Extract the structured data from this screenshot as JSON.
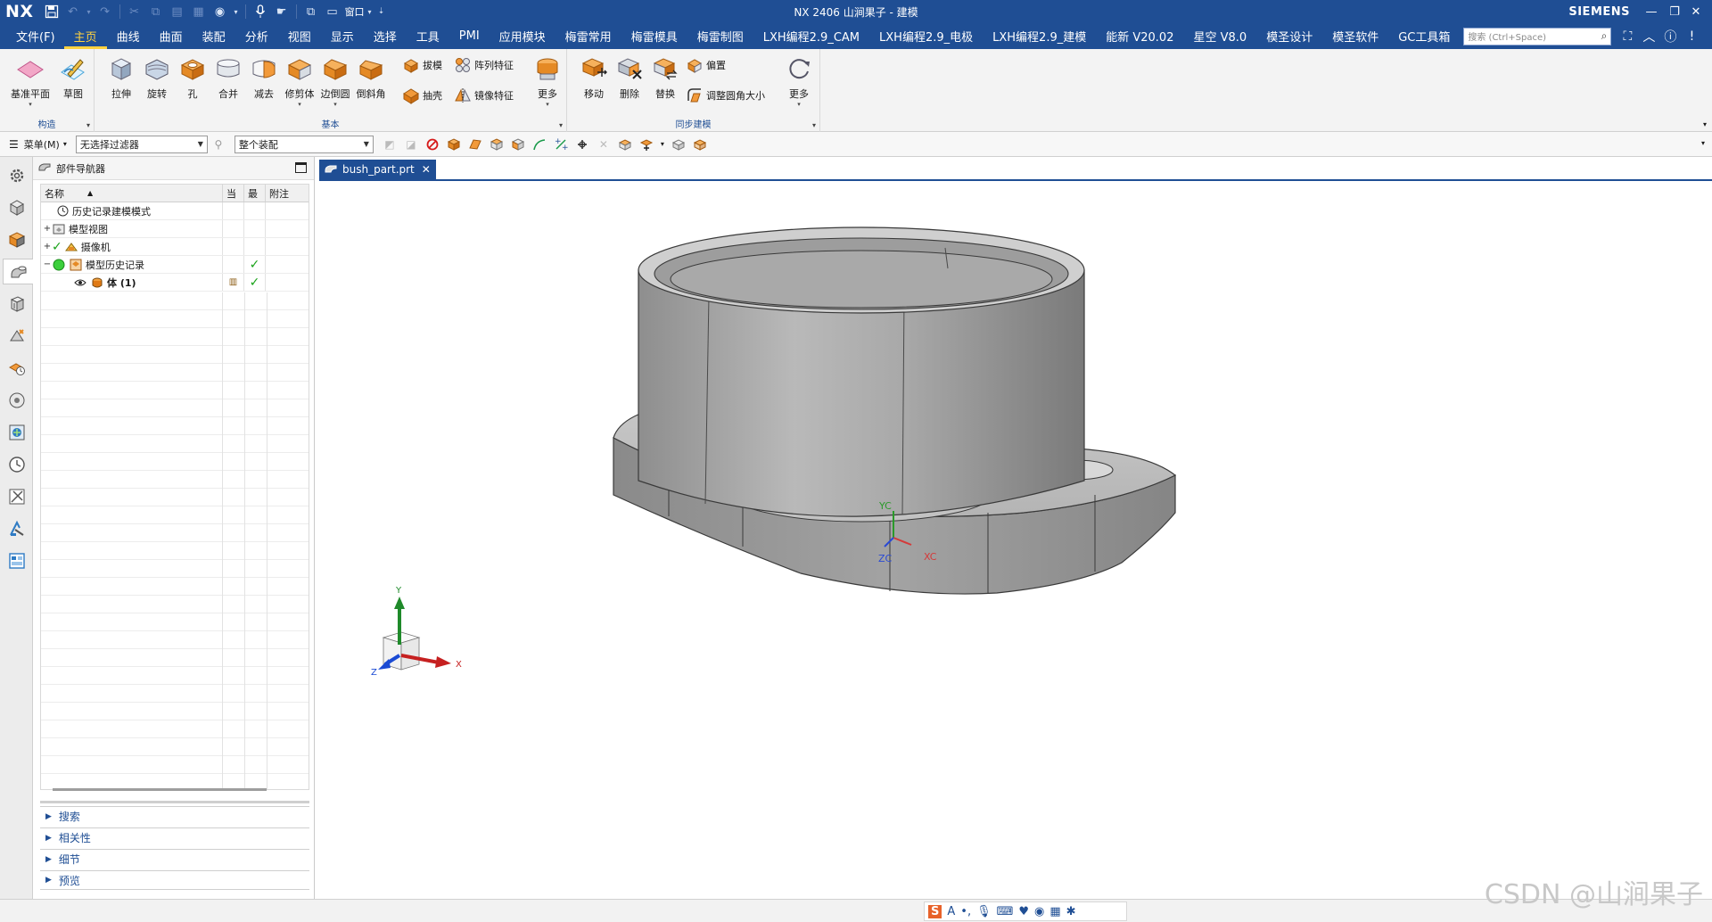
{
  "app": {
    "logo": "NX",
    "title": "NX 2406 山涧果子 - 建模",
    "brand": "SIEMENS",
    "window_menu_label": "窗口"
  },
  "tabs": [
    {
      "label": "文件(F)"
    },
    {
      "label": "主页",
      "active": true
    },
    {
      "label": "曲线"
    },
    {
      "label": "曲面"
    },
    {
      "label": "装配"
    },
    {
      "label": "分析"
    },
    {
      "label": "视图"
    },
    {
      "label": "显示"
    },
    {
      "label": "选择"
    },
    {
      "label": "工具"
    },
    {
      "label": "PMI"
    },
    {
      "label": "应用模块"
    },
    {
      "label": "梅雷常用"
    },
    {
      "label": "梅雷模具"
    },
    {
      "label": "梅雷制图"
    },
    {
      "label": "LXH编程2.9_CAM"
    },
    {
      "label": "LXH编程2.9_电极"
    },
    {
      "label": "LXH编程2.9_建模"
    },
    {
      "label": "能新 V20.02"
    },
    {
      "label": "星空 V8.0"
    },
    {
      "label": "模圣设计"
    },
    {
      "label": "模圣软件"
    },
    {
      "label": "GC工具箱"
    }
  ],
  "search": {
    "placeholder": "搜索 (Ctrl+Space)"
  },
  "ribbon": {
    "construct": {
      "title": "构造",
      "datum_plane": "基准平面",
      "sketch": "草图"
    },
    "basic": {
      "title": "基本",
      "extrude": "拉伸",
      "revolve": "旋转",
      "hole": "孔",
      "unite": "合并",
      "subtract": "减去",
      "trim_body": "修剪体",
      "edge_blend": "边倒圆",
      "chamfer": "倒斜角",
      "draft": "拔模",
      "shell": "抽壳",
      "pattern": "阵列特征",
      "mirror": "镜像特征",
      "more": "更多"
    },
    "sync": {
      "title": "同步建模",
      "move": "移动",
      "delete": "删除",
      "replace": "替换",
      "offset": "偏置",
      "resize_blend": "调整圆角大小",
      "more": "更多"
    }
  },
  "selection_bar": {
    "menu_label": "菜单(M)",
    "filter_value": "无选择过滤器",
    "scope_value": "整个装配"
  },
  "navigator": {
    "title": "部件导航器",
    "columns": {
      "name": "名称",
      "current": "当",
      "latest": "最",
      "note": "附注"
    },
    "rows": [
      {
        "label": "历史记录建模模式"
      },
      {
        "label": "模型视图"
      },
      {
        "label": "摄像机"
      },
      {
        "label": "模型历史记录"
      },
      {
        "label": "体 (1)"
      }
    ],
    "sections": [
      "搜索",
      "相关性",
      "细节",
      "预览"
    ]
  },
  "document": {
    "tab_label": "bush_part.prt"
  },
  "viewport": {
    "csys_labels": {
      "yc": "YC",
      "zc": "ZC",
      "xc": "XC"
    },
    "triad_labels": {
      "x": "X",
      "y": "Y",
      "z": "Z"
    }
  },
  "watermark": "CSDN @山涧果子",
  "colors": {
    "accent": "#1f4e94",
    "active_tab": "#ffd23f",
    "ok_check": "#1aa31a"
  }
}
